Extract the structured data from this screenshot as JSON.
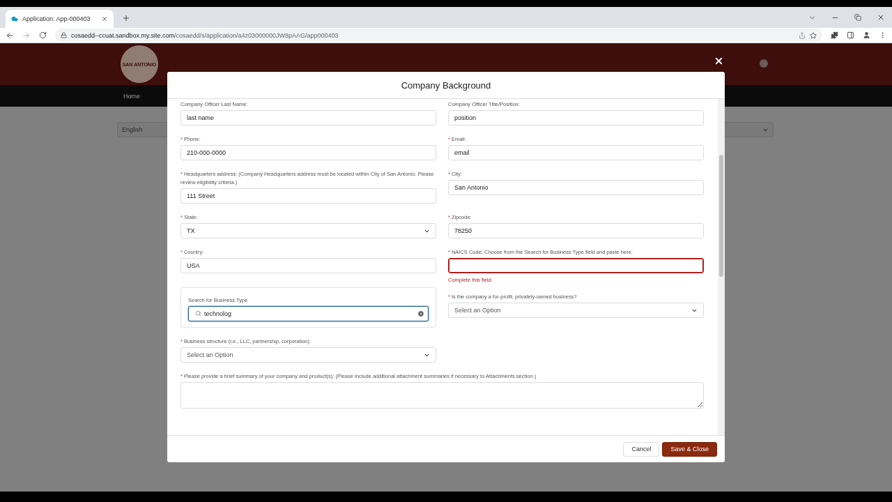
{
  "browser": {
    "tab_title": "Application: App-000403",
    "url_host": "cosaedd--ccuat.sandbox.my.site.com",
    "url_path": "/cosaedd/s/application/a4z03000000JW8pAAG/app000403"
  },
  "site": {
    "logo_text": "SAN ANTONIO",
    "nav": [
      {
        "label": "Home",
        "selected": false
      }
    ],
    "language": "English"
  },
  "modal": {
    "title": "Company Background",
    "rows": [
      [
        {
          "kind": "text",
          "label": "Company Officer Last Name:",
          "value": "last name"
        },
        {
          "kind": "text",
          "label": "Company Officer Title/Position:",
          "value": "position"
        }
      ],
      [
        {
          "kind": "text",
          "mark": "*",
          "label": "Phone:",
          "value": "210-000-0000"
        },
        {
          "kind": "text",
          "mark": "*",
          "label": "Email:",
          "value": "email"
        }
      ],
      [
        {
          "kind": "text",
          "mark": "*",
          "label": "Headquarters address: (Company Headquarters address must be located within City of San Antonio. Please review eligibility criteria.)",
          "value": "111 Street"
        },
        {
          "kind": "text",
          "mark": "*",
          "label": "City:",
          "value": "San Antonio"
        }
      ],
      [
        {
          "kind": "select",
          "mark": "*",
          "label": "State:",
          "value": "TX"
        },
        {
          "kind": "text",
          "mark": "*",
          "label": "Zipcode:",
          "value": "78250"
        }
      ],
      [
        {
          "kind": "text",
          "mark": "*",
          "label": "Country:",
          "value": "USA"
        },
        {
          "kind": "text",
          "mark": "*",
          "label": "NAICS Code: Choose from the Search for Business Type field and paste here.",
          "error": "Complete this field."
        }
      ],
      [
        {
          "kind": "search",
          "label": "Search for Business Type",
          "value": "technolog"
        },
        {
          "kind": "select",
          "mark": "*",
          "label": "Is the company a for-profit, privately-owned business?",
          "placeholder": "Select an Option"
        }
      ],
      [
        {
          "kind": "select",
          "mark": "*",
          "label": "Business structure (i.e., LLC, partnership, corporation):",
          "placeholder": "Select an Option"
        }
      ],
      [
        {
          "kind": "textarea",
          "mark": "*",
          "label": "Please provide a brief summary of your company and product(s): (Please include additional attachment summaries if necessary to Attachments section.)"
        }
      ]
    ],
    "buttons": [
      {
        "label": "Cancel",
        "kind": "neutral"
      },
      {
        "label": "Save & Close",
        "kind": "brand"
      }
    ]
  }
}
